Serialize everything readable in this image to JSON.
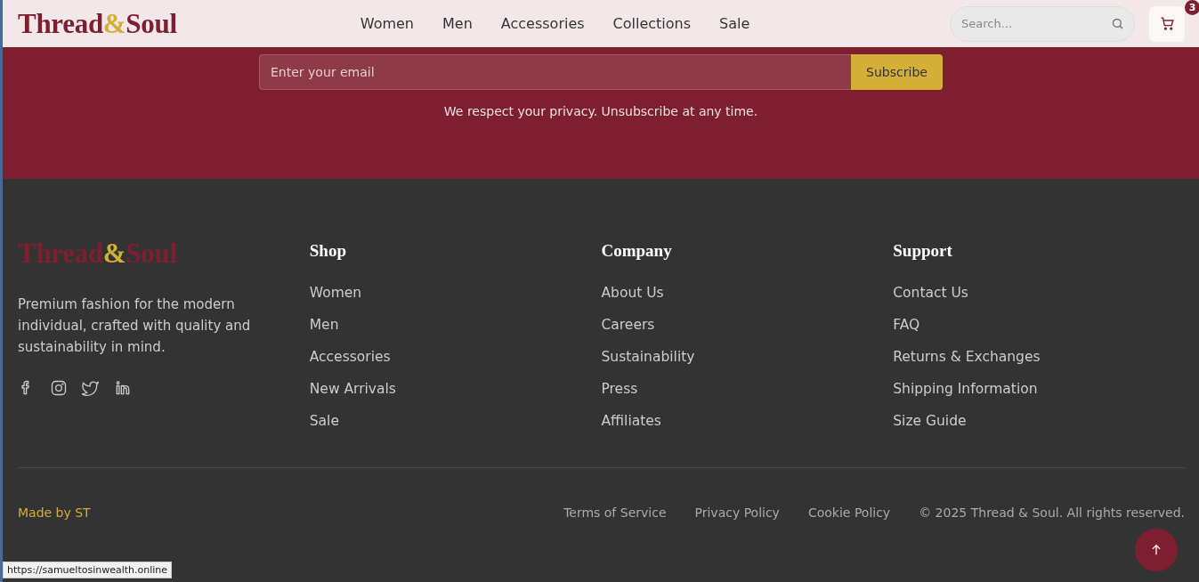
{
  "header": {
    "logo": {
      "start": "Thread",
      "amp": "&",
      "end": "Soul"
    },
    "nav": [
      {
        "label": "Women"
      },
      {
        "label": "Men"
      },
      {
        "label": "Accessories"
      },
      {
        "label": "Collections"
      },
      {
        "label": "Sale"
      }
    ],
    "search": {
      "placeholder": "Search..."
    },
    "cart": {
      "count": "3"
    }
  },
  "newsletter": {
    "email": {
      "placeholder": "Enter your email"
    },
    "button": "Subscribe",
    "note": "We respect your privacy. Unsubscribe at any time."
  },
  "footer": {
    "logo": {
      "start": "Thread",
      "amp": "&",
      "end": "Soul"
    },
    "tagline": "Premium fashion for the modern individual, crafted with quality and sustainability in mind.",
    "social": [
      {
        "kind": "facebook"
      },
      {
        "kind": "instagram"
      },
      {
        "kind": "twitter"
      },
      {
        "kind": "linkedin"
      }
    ],
    "columns": [
      {
        "heading": "Shop",
        "links": [
          "Women",
          "Men",
          "Accessories",
          "New Arrivals",
          "Sale"
        ]
      },
      {
        "heading": "Company",
        "links": [
          "About Us",
          "Careers",
          "Sustainability",
          "Press",
          "Affiliates"
        ]
      },
      {
        "heading": "Support",
        "links": [
          "Contact Us",
          "FAQ",
          "Returns & Exchanges",
          "Shipping Information",
          "Size Guide"
        ]
      }
    ],
    "made_by": "Made by ST",
    "legal_links": [
      "Terms of Service",
      "Privacy Policy",
      "Cookie Policy"
    ],
    "copyright": "© 2025 Thread & Soul. All rights reserved."
  },
  "status_url": "https://samueltosinwealth.online"
}
